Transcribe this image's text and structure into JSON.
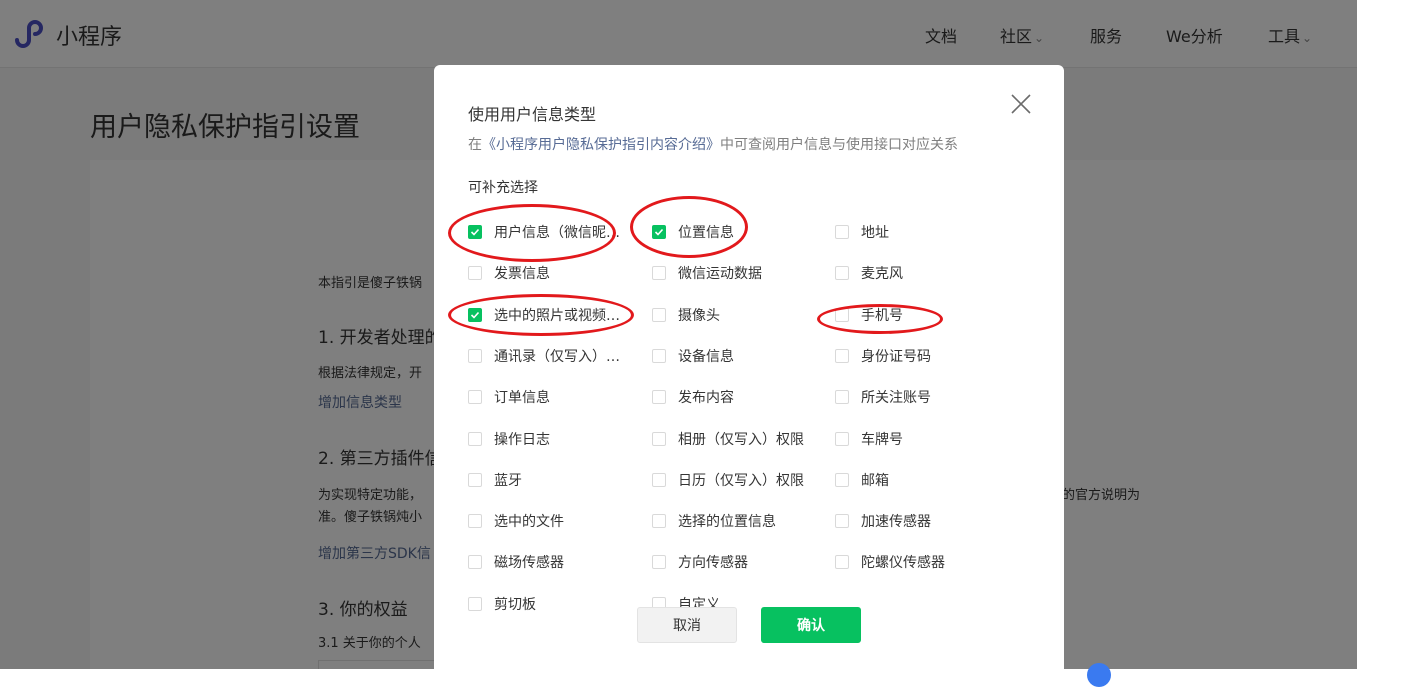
{
  "header": {
    "logo_text": "小程序",
    "nav": [
      {
        "label": "文档",
        "dropdown": false
      },
      {
        "label": "社区",
        "dropdown": true
      },
      {
        "label": "服务",
        "dropdown": false
      },
      {
        "label": "We分析",
        "dropdown": false
      },
      {
        "label": "工具",
        "dropdown": true
      }
    ]
  },
  "background": {
    "page_title": "用户隐私保护指引设置",
    "lines": [
      "本指引是傻子铁锅",
      "1. 开发者处理的",
      "根据法律规定，开",
      "2. 第三方插件信",
      "为实现特定功能，",
      "准。傻子铁锅炖小",
      "3. 你的权益",
      "3.1 关于你的个人",
      "的官方说明为"
    ],
    "links": [
      "增加信息类型",
      "增加第三方SDK信"
    ]
  },
  "modal": {
    "title": "使用用户信息类型",
    "desc_prefix": "在",
    "desc_link": "《小程序用户隐私保护指引内容介绍》",
    "desc_suffix": "中可查阅用户信息与使用接口对应关系",
    "section_label": "可补充选择",
    "options": [
      {
        "label": "用户信息（微信昵称、头像）",
        "checked": true
      },
      {
        "label": "位置信息",
        "checked": true
      },
      {
        "label": "地址",
        "checked": false
      },
      {
        "label": "发票信息",
        "checked": false
      },
      {
        "label": "微信运动数据",
        "checked": false
      },
      {
        "label": "麦克风",
        "checked": false
      },
      {
        "label": "选中的照片或视频信息",
        "checked": true
      },
      {
        "label": "摄像头",
        "checked": false
      },
      {
        "label": "手机号",
        "checked": false
      },
      {
        "label": "通讯录（仅写入）权限",
        "checked": false
      },
      {
        "label": "设备信息",
        "checked": false
      },
      {
        "label": "身份证号码",
        "checked": false
      },
      {
        "label": "订单信息",
        "checked": false
      },
      {
        "label": "发布内容",
        "checked": false
      },
      {
        "label": "所关注账号",
        "checked": false
      },
      {
        "label": "操作日志",
        "checked": false
      },
      {
        "label": "相册（仅写入）权限",
        "checked": false
      },
      {
        "label": "车牌号",
        "checked": false
      },
      {
        "label": "蓝牙",
        "checked": false
      },
      {
        "label": "日历（仅写入）权限",
        "checked": false
      },
      {
        "label": "邮箱",
        "checked": false
      },
      {
        "label": "选中的文件",
        "checked": false
      },
      {
        "label": "选择的位置信息",
        "checked": false
      },
      {
        "label": "加速传感器",
        "checked": false
      },
      {
        "label": "磁场传感器",
        "checked": false
      },
      {
        "label": "方向传感器",
        "checked": false
      },
      {
        "label": "陀螺仪传感器",
        "checked": false
      },
      {
        "label": "剪切板",
        "checked": false
      },
      {
        "label": "自定义",
        "checked": false
      }
    ],
    "cancel_label": "取消",
    "confirm_label": "确认"
  },
  "colors": {
    "accent_green": "#07c160",
    "link_blue": "#576b95",
    "annotation_red": "#e2191c"
  }
}
